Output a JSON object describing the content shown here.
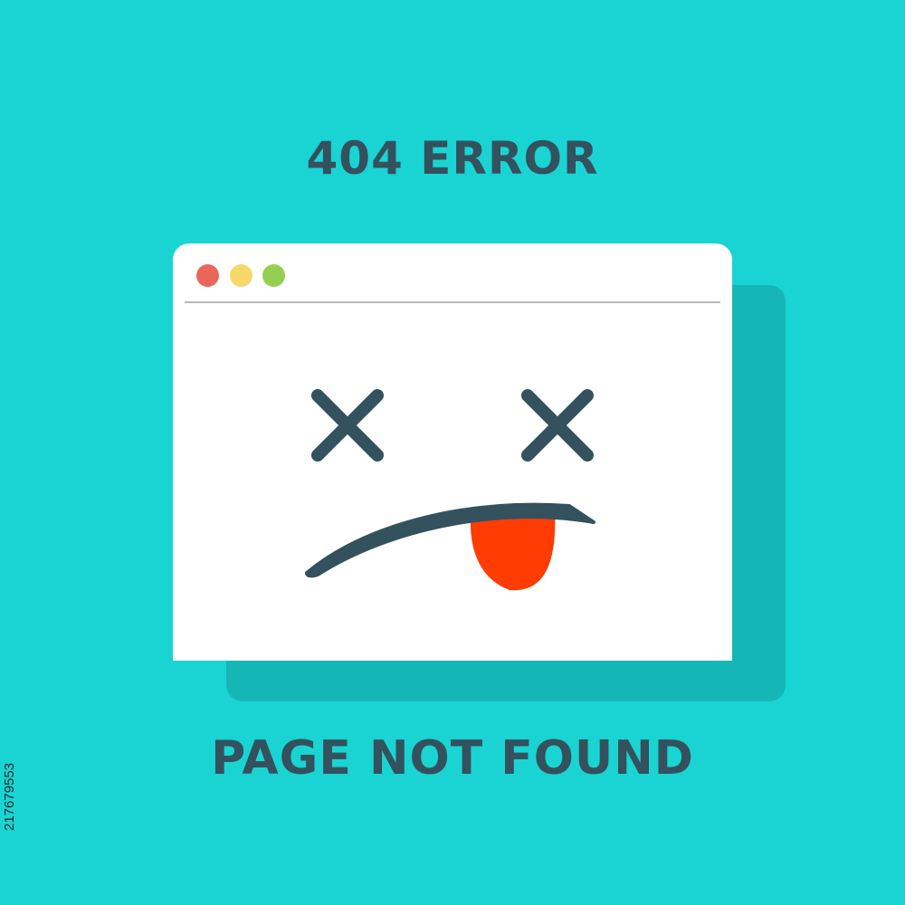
{
  "header": {
    "title": "404 ERROR"
  },
  "footer": {
    "message": "PAGE NOT FOUND"
  },
  "watermark": {
    "image_id": "217679553"
  },
  "window": {
    "controls": [
      {
        "name": "close-dot",
        "color": "#e8675a"
      },
      {
        "name": "minimize-dot",
        "color": "#f6d76a"
      },
      {
        "name": "maximize-dot",
        "color": "#94cf52"
      }
    ]
  },
  "illustration": {
    "face": "dead-face-tongue",
    "eye_color": "#34515e",
    "tongue_color": "#fe3c03"
  },
  "colors": {
    "background": "#19d4d2",
    "shadow": "#15b7b6",
    "window": "#ffffff",
    "text": "#34515e"
  }
}
